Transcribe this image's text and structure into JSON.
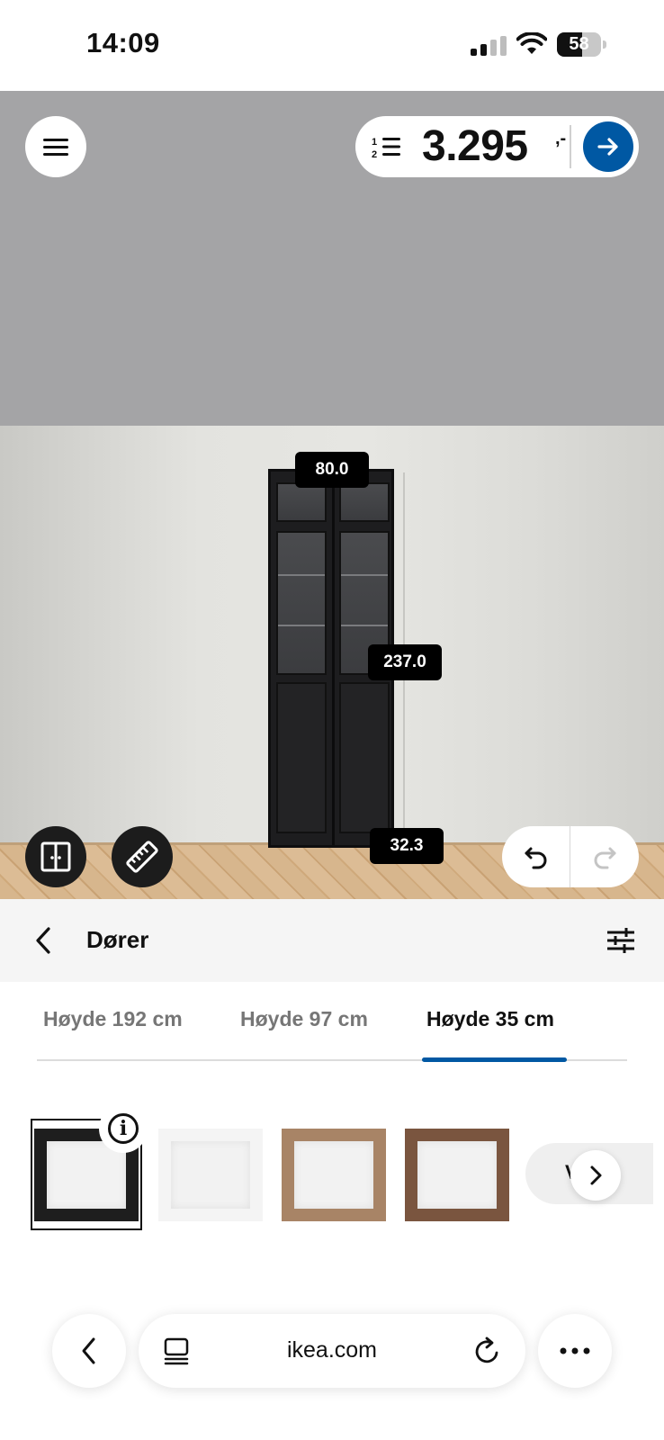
{
  "status_bar": {
    "time": "14:09",
    "battery": "58",
    "battery_level": 0.58
  },
  "toolbar": {
    "menu_icon": "hamburger-icon",
    "price": "3.295",
    "price_suffix": ",-",
    "list_icon": "numbered-list-icon",
    "go_icon": "arrow-right-icon"
  },
  "scene": {
    "dimension_width": "80.0",
    "dimension_height": "237.0",
    "dimension_depth": "32.3",
    "tools": [
      "doors-icon",
      "ruler-icon"
    ],
    "undo_icon": "undo-icon",
    "redo_icon": "redo-icon"
  },
  "panel": {
    "title": "Dører",
    "back_icon": "chevron-left-icon",
    "filter_icon": "sliders-icon",
    "tabs": [
      {
        "label": "Høyde 192 cm",
        "active": false
      },
      {
        "label": "Høyde 97 cm",
        "active": false
      },
      {
        "label": "Høyde 35 cm",
        "active": true
      }
    ],
    "swatches": [
      {
        "name": "black-brown",
        "color": "#1e1e1e",
        "selected": true
      },
      {
        "name": "white",
        "color": "#f4f4f4",
        "selected": false
      },
      {
        "name": "oak-effect",
        "color": "#a88466",
        "selected": false
      },
      {
        "name": "walnut-effect",
        "color": "#7a553f",
        "selected": false
      }
    ],
    "more_label": "V   e",
    "info_icon": "info-icon",
    "next_icon": "chevron-right-icon"
  },
  "browser": {
    "url": "ikea.com",
    "back_icon": "chevron-left-icon",
    "tabs_icon": "tabs-icon",
    "reload_icon": "reload-icon",
    "more_icon": "ellipsis-icon"
  },
  "colors": {
    "accent": "#0058a3",
    "ceiling": "#a4a4a6",
    "panel_bg": "#f5f5f5"
  }
}
